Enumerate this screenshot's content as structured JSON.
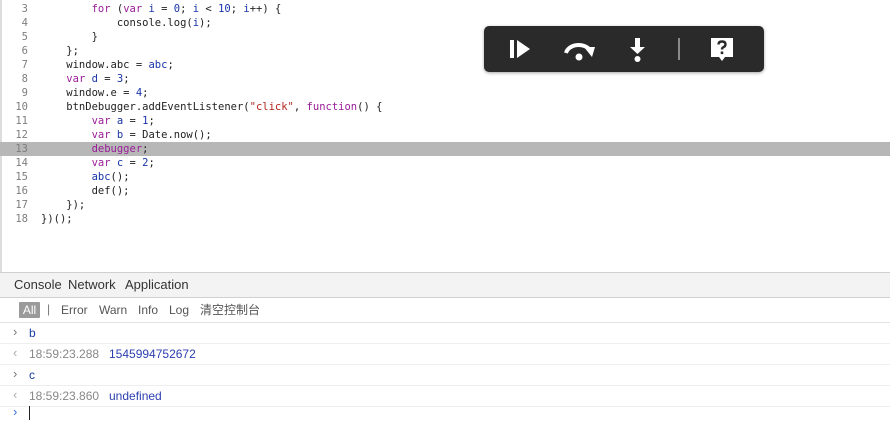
{
  "editor": {
    "lines": [
      {
        "n": "3",
        "tokens": [
          {
            "t": "        "
          },
          {
            "t": "for",
            "c": "kw"
          },
          {
            "t": " ("
          },
          {
            "t": "var",
            "c": "kw"
          },
          {
            "t": " "
          },
          {
            "t": "i",
            "c": "var"
          },
          {
            "t": " = "
          },
          {
            "t": "0",
            "c": "num"
          },
          {
            "t": "; "
          },
          {
            "t": "i",
            "c": "var"
          },
          {
            "t": " < "
          },
          {
            "t": "10",
            "c": "num"
          },
          {
            "t": "; "
          },
          {
            "t": "i",
            "c": "var"
          },
          {
            "t": "++) {"
          }
        ]
      },
      {
        "n": "4",
        "tokens": [
          {
            "t": "            console.log("
          },
          {
            "t": "i",
            "c": "var"
          },
          {
            "t": ");"
          }
        ]
      },
      {
        "n": "5",
        "tokens": [
          {
            "t": "        }"
          }
        ]
      },
      {
        "n": "6",
        "tokens": [
          {
            "t": "    };"
          }
        ]
      },
      {
        "n": "7",
        "tokens": [
          {
            "t": "    window.abc = "
          },
          {
            "t": "abc",
            "c": "var"
          },
          {
            "t": ";"
          }
        ]
      },
      {
        "n": "8",
        "tokens": [
          {
            "t": "    "
          },
          {
            "t": "var",
            "c": "kw"
          },
          {
            "t": " "
          },
          {
            "t": "d",
            "c": "var"
          },
          {
            "t": " = "
          },
          {
            "t": "3",
            "c": "num"
          },
          {
            "t": ";"
          }
        ]
      },
      {
        "n": "9",
        "tokens": [
          {
            "t": "    window.e = "
          },
          {
            "t": "4",
            "c": "num"
          },
          {
            "t": ";"
          }
        ]
      },
      {
        "n": "10",
        "tokens": [
          {
            "t": "    btnDebugger.addEventListener("
          },
          {
            "t": "\"click\"",
            "c": "str"
          },
          {
            "t": ", "
          },
          {
            "t": "function",
            "c": "kw"
          },
          {
            "t": "() {"
          }
        ]
      },
      {
        "n": "11",
        "tokens": [
          {
            "t": "        "
          },
          {
            "t": "var",
            "c": "kw"
          },
          {
            "t": " "
          },
          {
            "t": "a",
            "c": "var"
          },
          {
            "t": " = "
          },
          {
            "t": "1",
            "c": "num"
          },
          {
            "t": ";"
          }
        ]
      },
      {
        "n": "12",
        "tokens": [
          {
            "t": "        "
          },
          {
            "t": "var",
            "c": "kw"
          },
          {
            "t": " "
          },
          {
            "t": "b",
            "c": "var"
          },
          {
            "t": " = Date.now();"
          }
        ]
      },
      {
        "n": "13",
        "highlighted": true,
        "tokens": [
          {
            "t": "        "
          },
          {
            "t": "debugger",
            "c": "kw"
          },
          {
            "t": ";"
          }
        ]
      },
      {
        "n": "14",
        "tokens": [
          {
            "t": "        "
          },
          {
            "t": "var",
            "c": "kw"
          },
          {
            "t": " "
          },
          {
            "t": "c",
            "c": "var"
          },
          {
            "t": " = "
          },
          {
            "t": "2",
            "c": "num"
          },
          {
            "t": ";"
          }
        ]
      },
      {
        "n": "15",
        "tokens": [
          {
            "t": "        "
          },
          {
            "t": "abc",
            "c": "var"
          },
          {
            "t": "();"
          }
        ]
      },
      {
        "n": "16",
        "tokens": [
          {
            "t": "        def();"
          }
        ]
      },
      {
        "n": "17",
        "tokens": [
          {
            "t": "    });"
          }
        ]
      },
      {
        "n": "18",
        "tokens": [
          {
            "t": "})();"
          }
        ]
      }
    ]
  },
  "debugger_toolbar": {
    "buttons": [
      {
        "name": "resume-icon"
      },
      {
        "name": "step-over-icon"
      },
      {
        "name": "step-into-icon"
      },
      {
        "name": "help-icon"
      }
    ]
  },
  "panel": {
    "tabs": [
      "Console",
      "Network",
      "Application"
    ]
  },
  "filters": {
    "all": "All",
    "sep": "|",
    "items": [
      "Error",
      "Warn",
      "Info",
      "Log",
      "清空控制台"
    ]
  },
  "console": {
    "entries": [
      {
        "kind": "input",
        "arrow": "›",
        "text": "b"
      },
      {
        "kind": "output",
        "arrow": "‹",
        "timestamp": "18:59:23.288",
        "value": "1545994752672"
      },
      {
        "kind": "input",
        "arrow": "›",
        "text": "c"
      },
      {
        "kind": "output",
        "arrow": "‹",
        "timestamp": "18:59:23.860",
        "value": "undefined"
      }
    ],
    "prompt": "›"
  },
  "colors": {
    "toolbar_bg": "#2a2a2a",
    "highlight_line": "#b7b7b7",
    "keyword": "#9a1c9a",
    "variable": "#1a36a8",
    "string": "#b3261e"
  }
}
